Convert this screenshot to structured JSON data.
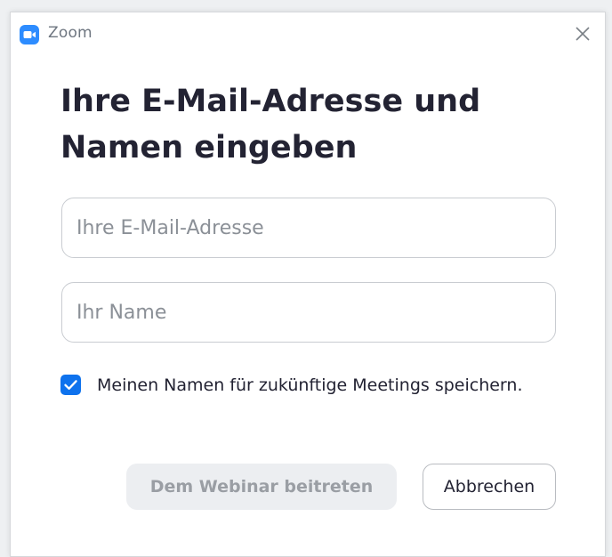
{
  "window": {
    "title": "Zoom",
    "app_icon": "zoom-camera-icon",
    "close_icon": "close-icon"
  },
  "dialog": {
    "heading": "Ihre E-Mail-Adresse und Namen eingeben",
    "email_field": {
      "placeholder": "Ihre E-Mail-Adresse",
      "value": ""
    },
    "name_field": {
      "placeholder": "Ihr Name",
      "value": ""
    },
    "remember_checkbox": {
      "checked": true,
      "label": "Meinen Namen für zukünftige Meetings speichern."
    },
    "join_button": {
      "label": "Dem Webinar beitreten",
      "enabled": false
    },
    "cancel_button": {
      "label": "Abbrechen"
    }
  },
  "colors": {
    "brand_blue": "#2d8cff",
    "checkbox_blue": "#0e72ed",
    "heading_text": "#232333",
    "disabled_button_bg": "#eceef1",
    "disabled_button_text": "#9a9ea4"
  }
}
